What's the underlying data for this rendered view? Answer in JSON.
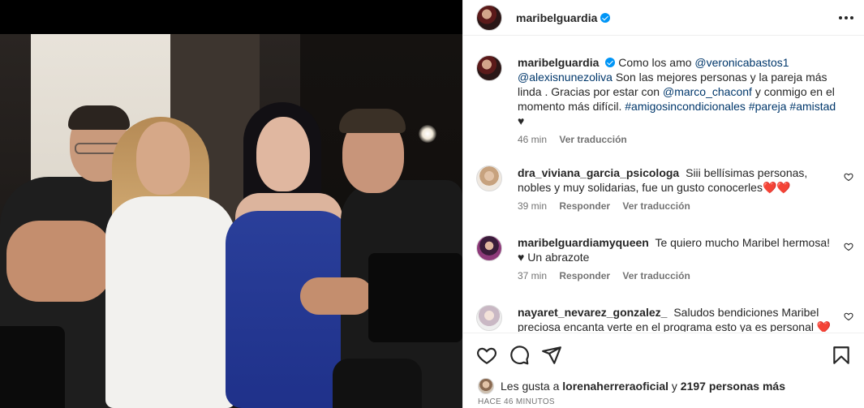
{
  "post": {
    "username": "maribelguardia"
  },
  "caption": {
    "username": "maribelguardia",
    "text_1": "Como los amo",
    "mention_1": "@veronicabastos1",
    "mention_2": "@alexisnunezoliva",
    "text_2": "Son las mejores personas y la pareja más linda . Gracias por estar con",
    "mention_3": "@marco_chaconf",
    "text_3": "y conmigo en el momento más difícil.",
    "tag_1": "#amigosincondicionales",
    "tag_2": "#pareja",
    "tag_3": "#amistad",
    "text_4": "♥",
    "time": "46 min",
    "translate": "Ver traducción"
  },
  "comments": [
    {
      "username": "dra_viviana_garcia_psicologa",
      "text": "Siii bellísimas personas, nobles y muy solidarias, fue un gusto conocerles❤️❤️",
      "time": "39 min",
      "reply": "Responder",
      "translate": "Ver traducción"
    },
    {
      "username": "maribelguardiamyqueen",
      "text": "Te quiero mucho Maribel hermosa! ♥ Un abrazote",
      "time": "37 min",
      "reply": "Responder",
      "translate": "Ver traducción"
    },
    {
      "username": "nayaret_nevarez_gonzalez_",
      "text": "Saludos bendiciones Maribel preciosa encanta verte en el programa esto ya es personal ❤️"
    }
  ],
  "likes": {
    "prefix": "Les gusta a",
    "user": "lorenaherreraoficial",
    "joiner": "y",
    "others": "2197 personas más"
  },
  "timestamp": "HACE 46 MINUTOS",
  "icons": {
    "verified": "verified-badge-icon",
    "more": "more-options-icon",
    "like": "heart-icon",
    "comment": "comment-bubble-icon",
    "share": "paper-plane-icon",
    "save": "bookmark-icon"
  },
  "colors": {
    "link": "#00376b",
    "verified": "#0095f6",
    "muted": "#737373"
  }
}
